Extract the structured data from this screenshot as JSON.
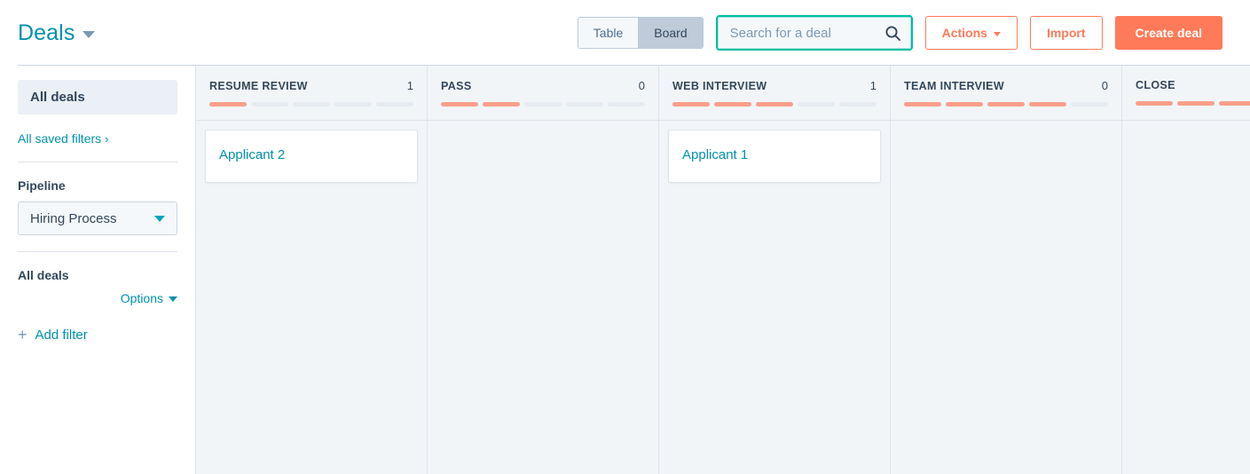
{
  "header": {
    "title": "Deals",
    "view_toggle": {
      "options": [
        "Table",
        "Board"
      ],
      "active": "Board"
    },
    "search": {
      "placeholder": "Search for a deal",
      "value": "",
      "icon": "search-icon"
    },
    "actions_label": "Actions",
    "import_label": "Import",
    "create_label": "Create deal"
  },
  "sidebar": {
    "all_deals_label": "All deals",
    "saved_filters_label": "All saved filters",
    "saved_filters_chevron": "›",
    "pipeline_label": "Pipeline",
    "pipeline_value": "Hiring Process",
    "filters_title": "All deals",
    "options_label": "Options",
    "add_filter_label": "Add filter",
    "add_filter_icon": "plus-icon"
  },
  "board": {
    "columns": [
      {
        "name": "RESUME REVIEW",
        "count": "1",
        "segments_total": 5,
        "segments_filled": 1,
        "cards": [
          {
            "title": "Applicant 2"
          }
        ]
      },
      {
        "name": "PASS",
        "count": "0",
        "segments_total": 5,
        "segments_filled": 2,
        "cards": []
      },
      {
        "name": "WEB INTERVIEW",
        "count": "1",
        "segments_total": 5,
        "segments_filled": 3,
        "cards": [
          {
            "title": "Applicant 1"
          }
        ]
      },
      {
        "name": "TEAM INTERVIEW",
        "count": "0",
        "segments_total": 5,
        "segments_filled": 4,
        "cards": []
      },
      {
        "name": "CLOSE",
        "count": "",
        "segments_total": 5,
        "segments_filled": 5,
        "cards": []
      }
    ]
  },
  "colors": {
    "brand_orange": "#ff7a59",
    "link_teal": "#0091ae",
    "focus_ring": "#00bda5",
    "text_navy": "#33475b",
    "progress_filled": "#f8a08a",
    "progress_empty": "#e5ebf0",
    "column_bg": "#f2f5f8"
  }
}
